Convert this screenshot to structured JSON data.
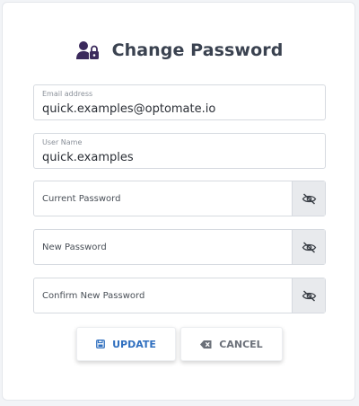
{
  "header": {
    "title": "Change Password",
    "icon": "user-lock-icon"
  },
  "fields": {
    "email": {
      "label": "Email address",
      "value": "quick.examples@optomate.io"
    },
    "username": {
      "label": "User Name",
      "value": "quick.examples"
    },
    "current_password": {
      "placeholder": "Current Password"
    },
    "new_password": {
      "placeholder": "New Password"
    },
    "confirm_password": {
      "placeholder": "Confirm New Password"
    }
  },
  "actions": {
    "update_label": "UPDATE",
    "cancel_label": "CANCEL"
  },
  "colors": {
    "icon_purple": "#3b2a5c",
    "primary_blue": "#2f6fbf",
    "muted_gray": "#6b7079"
  }
}
